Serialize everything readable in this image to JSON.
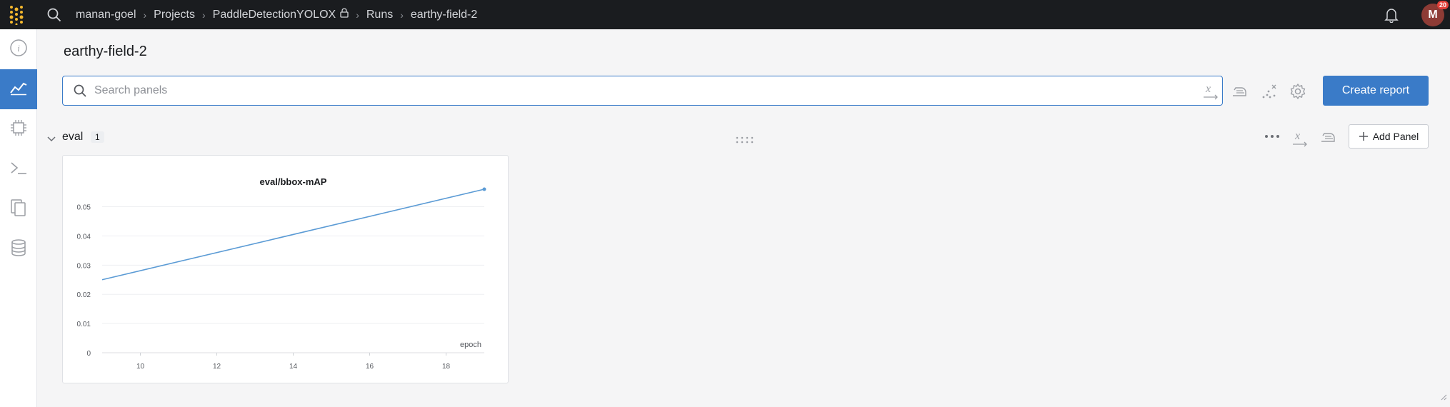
{
  "topbar": {
    "breadcrumbs": [
      "manan-goel",
      "Projects",
      "PaddleDetectionYOLOX",
      "Runs",
      "earthy-field-2"
    ],
    "avatar_initial": "M",
    "avatar_badge": "20"
  },
  "leftnav": {
    "items": [
      {
        "icon": "info-icon",
        "active": false
      },
      {
        "icon": "charts-icon",
        "active": true
      },
      {
        "icon": "cpu-icon",
        "active": false
      },
      {
        "icon": "terminal-icon",
        "active": false
      },
      {
        "icon": "files-icon",
        "active": false
      },
      {
        "icon": "database-icon",
        "active": false
      }
    ]
  },
  "main": {
    "run_title": "earthy-field-2",
    "search_placeholder": "Search panels",
    "create_report_label": "Create report"
  },
  "section": {
    "name": "eval",
    "count": "1",
    "add_panel_label": "Add Panel"
  },
  "colors": {
    "accent": "#3a7bc8",
    "topbar_bg": "#1a1c1f",
    "line": "#5b9bd5"
  },
  "chart_data": {
    "type": "line",
    "title": "eval/bbox-mAP",
    "xlabel": "epoch",
    "ylabel": "",
    "xlim": [
      9,
      19
    ],
    "ylim": [
      0,
      0.056
    ],
    "xticks": [
      10,
      12,
      14,
      16,
      18
    ],
    "yticks": [
      0,
      0.01,
      0.02,
      0.03,
      0.04,
      0.05
    ],
    "ytick_labels": [
      "0",
      "0.01",
      "0.02",
      "0.03",
      "0.04",
      "0.05"
    ],
    "grid": true,
    "series": [
      {
        "x": [
          9,
          19
        ],
        "y": [
          0.025,
          0.056
        ]
      }
    ]
  }
}
